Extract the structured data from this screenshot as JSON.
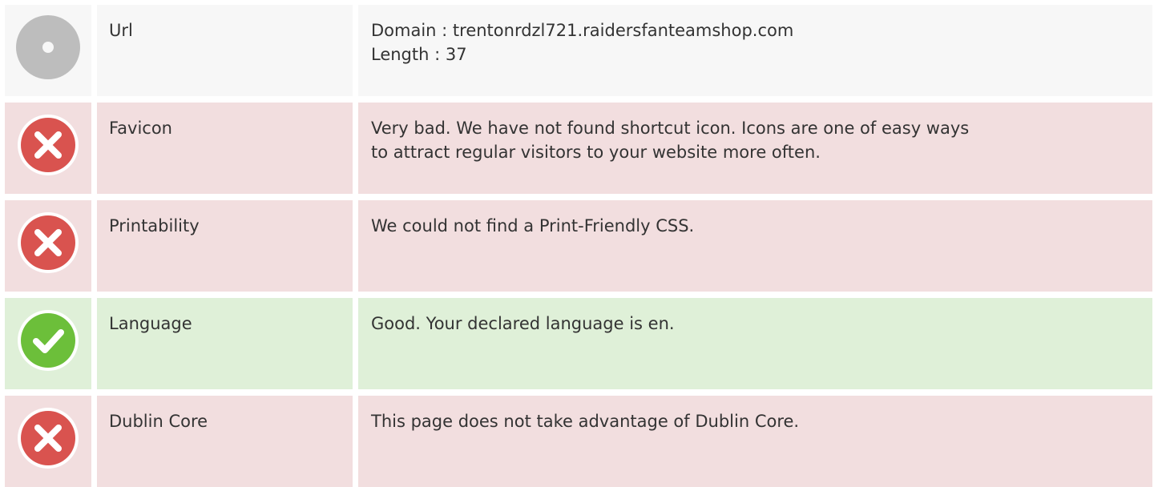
{
  "rows": [
    {
      "status": "neutral",
      "icon": "neutral-dot-icon",
      "label": "Url",
      "lines": [
        "Domain : trentonrdzl721.raidersfanteamshop.com",
        "Length : 37"
      ]
    },
    {
      "status": "bad",
      "icon": "error-x-icon",
      "label": "Favicon",
      "lines": [
        "Very bad. We have not found shortcut icon. Icons are one of easy ways",
        "to attract regular visitors to your website more often."
      ]
    },
    {
      "status": "bad",
      "icon": "error-x-icon",
      "label": "Printability",
      "lines": [
        "We could not find a Print-Friendly CSS."
      ]
    },
    {
      "status": "good",
      "icon": "check-icon",
      "label": "Language",
      "lines": [
        "Good. Your declared language is en."
      ]
    },
    {
      "status": "bad",
      "icon": "error-x-icon",
      "label": "Dublin Core",
      "lines": [
        "This page does not take advantage of Dublin Core."
      ]
    }
  ],
  "colors": {
    "neutral_bg": "#f7f7f7",
    "bad_bg": "#f2dedf",
    "good_bg": "#dff0d8",
    "error_icon": "#d9534f",
    "check_icon": "#6cbf3a",
    "neutral_icon": "#bdbdbd"
  }
}
